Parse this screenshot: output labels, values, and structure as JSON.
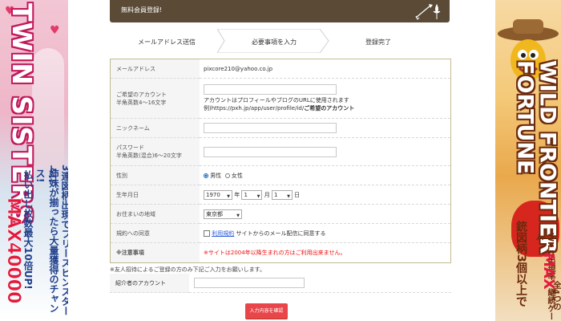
{
  "header": {
    "title": "無料会員登録!"
  },
  "steps": [
    "メールアドレス送信",
    "必要事項を入力",
    "登録完了"
  ],
  "form": {
    "email": {
      "label": "メールアドレス",
      "value": "pixcore210@yahoo.co.jp"
    },
    "account": {
      "label1": "ご希望のアカウント",
      "label2": "半角英数4～16文字",
      "help1": "アカウントはプロフィールやブログのURLに使用されます",
      "help2_prefix": "例)https://pxh.jp/app/user/profile/id/",
      "help2_bold": "ご希望のアカウント"
    },
    "nickname": {
      "label": "ニックネーム"
    },
    "password": {
      "label1": "パスワード",
      "label2": "半角英数(混合)6～20文字"
    },
    "gender": {
      "label": "性別",
      "male": "男性",
      "female": "女性",
      "selected": "male"
    },
    "birthday": {
      "label": "生年月日",
      "year": "1970",
      "year_unit": "年",
      "month": "1",
      "month_unit": "月",
      "day": "1",
      "day_unit": "日"
    },
    "region": {
      "label": "お住まいの地域",
      "value": "東京都"
    },
    "terms": {
      "label": "規約への同意",
      "link": "利用規約",
      "text": "サイトからのメール配信に同意する"
    },
    "caution": {
      "label": "※注意事項",
      "text": "※サイトは2004年以降生まれの方はご利用出来ません。"
    }
  },
  "note": "※友人招待によるご登録の方のみ下記ご入力をお願いします。",
  "referrer": {
    "label": "紹介者のアカウント"
  },
  "submit": "入力内容を確認",
  "banner_left": {
    "title": "TWIN SISTERS",
    "line1": "3連図柄出現でフリースピンスタート!!",
    "line2": "姉妹が揃ったら大量獲得のチャンス!",
    "line3": "払い出し枚数最大10倍UP!",
    "max": "MAX40000"
  },
  "banner_right": {
    "title": "WILD FRONTIER FORTUNE",
    "line1": "銃図柄3個以上で",
    "line2": "WILD出現率、継続ゲーム",
    "line3": "全4つの",
    "max": "MAX"
  },
  "colors": {
    "header_bg": "#5b4a36",
    "submit_bg": "#e8464a",
    "border": "#c2bb8f",
    "caution_red": "#ee1111"
  }
}
